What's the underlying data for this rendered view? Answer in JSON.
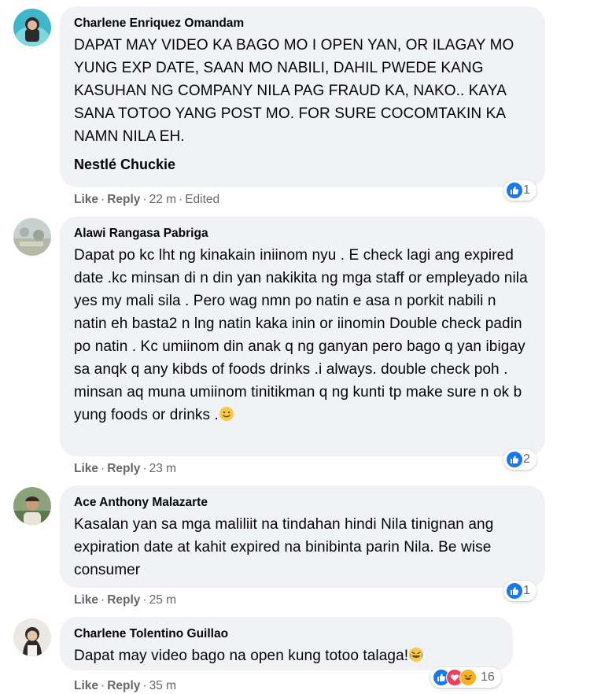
{
  "comments": [
    {
      "author": "Charlene Enriquez Omandam",
      "text": "DAPAT MAY VIDEO KA BAGO MO I OPEN YAN, OR ILAGAY MO YUNG EXP DATE, SAAN MO NABILI, DAHIL PWEDE KANG KASUHAN NG COMPANY NILA PAG FRAUD KA, NAKO.. KAYA SANA TOTOO YANG POST MO. FOR SURE COCOMTAKIN KA NAMN NILA EH.",
      "mention": "Nestlé Chuckie",
      "like_label": "Like",
      "reply_label": "Reply",
      "time": "22 m",
      "edited": "Edited",
      "reaction_count": "1"
    },
    {
      "author": "Alawi Rangasa Pabriga",
      "text": "Dapat po kc lht ng kinakain iniinom nyu . E check lagi ang expired date .kc minsan di n din yan nakikita ng mga staff or empleyado nila yes my mali sila . Pero wag nmn po natin e asa n porkit nabili n natin eh basta2 n lng natin kaka inin or iinomin Double check padin po natin . Kc umiinom din anak q ng ganyan pero bago q yan ibigay sa anqk q any kibds of foods drinks .i always. double check poh . minsan aq muna umiinom tinitikman q ng kunti tp make sure n ok b yung foods or drinks .",
      "like_label": "Like",
      "reply_label": "Reply",
      "time": "23 m",
      "reaction_count": "2"
    },
    {
      "author": "Ace Anthony Malazarte",
      "text": "Kasalan yan sa mga maliliit na tindahan hindi Nila tinignan ang expiration date at kahit expired na binibinta parin Nila. Be wise consumer",
      "like_label": "Like",
      "reply_label": "Reply",
      "time": "25 m",
      "reaction_count": "1"
    },
    {
      "author": "Charlene Tolentino Guillao",
      "text": "Dapat may video bago na open kung totoo talaga!",
      "like_label": "Like",
      "reply_label": "Reply",
      "time": "35 m",
      "reaction_count": "16"
    }
  ],
  "colors": {
    "bubble": "#f0f2f5",
    "secondary_text": "#65676b",
    "like_blue": "#1877f2",
    "love_red": "#f33e58",
    "haha_yellow": "#f7b125"
  }
}
